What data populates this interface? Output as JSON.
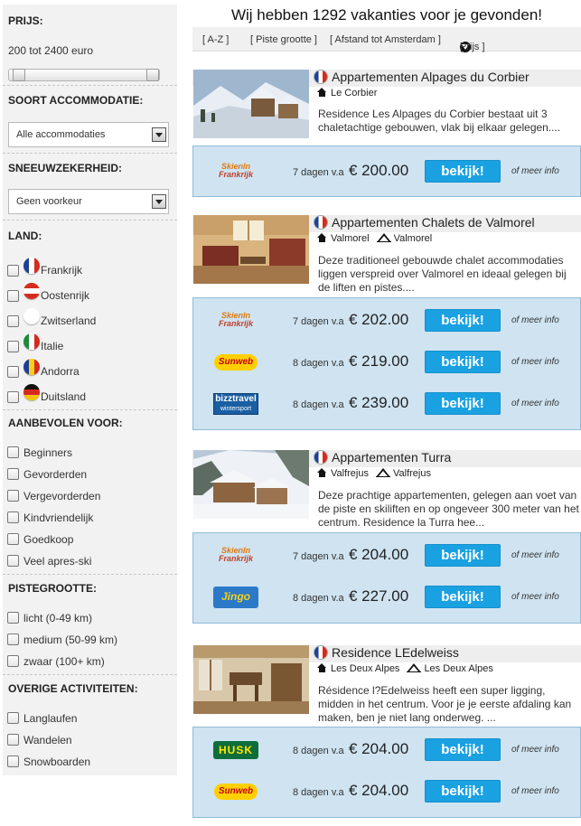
{
  "sidebar": {
    "price": {
      "title": "PRIJS:",
      "range": "200 tot 2400 euro"
    },
    "accommodation": {
      "title": "SOORT ACCOMMODATIE:",
      "selected": "Alle accommodaties"
    },
    "snow": {
      "title": "SNEEUWZEKERHEID:",
      "selected": "Geen voorkeur"
    },
    "country": {
      "title": "LAND:",
      "items": [
        {
          "label": "Frankrijk",
          "flag": "france-flag-icon"
        },
        {
          "label": "Oostenrijk",
          "flag": "austria-flag-icon"
        },
        {
          "label": "Zwitserland",
          "flag": "switzerland-flag-icon"
        },
        {
          "label": "Italie",
          "flag": "italy-flag-icon"
        },
        {
          "label": "Andorra",
          "flag": "andorra-flag-icon"
        },
        {
          "label": "Duitsland",
          "flag": "germany-flag-icon"
        }
      ]
    },
    "recommended": {
      "title": "AANBEVOLEN VOOR:",
      "items": [
        "Beginners",
        "Gevorderden",
        "Vergevorderden",
        "Kindvriendelijk",
        "Goedkoop",
        "Veel apres-ski"
      ]
    },
    "piste": {
      "title": "PISTEGROOTTE:",
      "items": [
        "licht (0-49 km)",
        "medium (50-99 km)",
        "zwaar (100+ km)"
      ]
    },
    "other": {
      "title": "OVERIGE ACTIVITEITEN:",
      "items": [
        "Langlaufen",
        "Wandelen",
        "Snowboarden"
      ]
    }
  },
  "main": {
    "title": "Wij hebben 1292 vakanties voor je gevonden!",
    "sort": {
      "az": "[ A-Z ]",
      "piste": "[ Piste grootte ]",
      "distance": "[ Afstand tot Amsterdam ]",
      "price_open": "[",
      "price": "Prijs ]"
    }
  },
  "results": [
    {
      "name": "Appartementen Alpages du Corbier",
      "town": "Le Corbier",
      "area": "",
      "desc": "Residence Les Alpages du Corbier bestaat uit 3 chaletachtige gebouwen, vlak bij elkaar gelegen....",
      "offers": [
        {
          "provider": "SkienInFrankrijk",
          "logo_line1": "SkienIn",
          "logo_line2": "Frankrijk",
          "duration": "7 dagen v.a",
          "price": "€ 200.00",
          "button": "bekijk!",
          "more": "of meer info"
        }
      ]
    },
    {
      "name": "Appartementen Chalets de Valmorel",
      "town": "Valmorel",
      "area": "Valmorel",
      "desc": "Deze traditioneel gebouwde chalet accommodaties liggen verspreid over Valmorel en ideaal gelegen bij de liften en pistes....",
      "offers": [
        {
          "provider": "SkienInFrankrijk",
          "logo_line1": "SkienIn",
          "logo_line2": "Frankrijk",
          "duration": "7 dagen v.a",
          "price": "€ 202.00",
          "button": "bekijk!",
          "more": "of meer info"
        },
        {
          "provider": "Sunweb",
          "logo_line1": "Sunweb",
          "logo_line2": "",
          "duration": "8 dagen v.a",
          "price": "€ 219.00",
          "button": "bekijk!",
          "more": "of meer info"
        },
        {
          "provider": "bizztravel",
          "logo_line1": "bizztravel",
          "logo_line2": "wintersport",
          "duration": "8 dagen v.a",
          "price": "€ 239.00",
          "button": "bekijk!",
          "more": "of meer info"
        }
      ]
    },
    {
      "name": "Appartementen Turra",
      "town": "Valfrejus",
      "area": "Valfrejus",
      "desc": "Deze prachtige appartementen, gelegen aan voet van de piste en skiliften en op ongeveer 300 meter van het centrum. Residence la Turra hee...",
      "offers": [
        {
          "provider": "SkienInFrankrijk",
          "logo_line1": "SkienIn",
          "logo_line2": "Frankrijk",
          "duration": "7 dagen v.a",
          "price": "€ 204.00",
          "button": "bekijk!",
          "more": "of meer info"
        },
        {
          "provider": "Jingo",
          "logo_line1": "Jingo",
          "logo_line2": "",
          "duration": "8 dagen v.a",
          "price": "€ 227.00",
          "button": "bekijk!",
          "more": "of meer info"
        }
      ]
    },
    {
      "name": "Residence LEdelweiss",
      "town": "Les Deux Alpes",
      "area": "Les Deux Alpes",
      "desc": "Résidence l?Edelweiss heeft een super ligging, midden in het centrum. Voor je je eerste afdaling kan maken, ben je niet lang onderweg. ...",
      "offers": [
        {
          "provider": "HUSK",
          "logo_line1": "HUSK",
          "logo_line2": "",
          "duration": "8 dagen v.a",
          "price": "€ 204.00",
          "button": "bekijk!",
          "more": "of meer info"
        },
        {
          "provider": "Sunweb",
          "logo_line1": "Sunweb",
          "logo_line2": "",
          "duration": "8 dagen v.a",
          "price": "€ 204.00",
          "button": "bekijk!",
          "more": "of meer info"
        }
      ]
    }
  ]
}
